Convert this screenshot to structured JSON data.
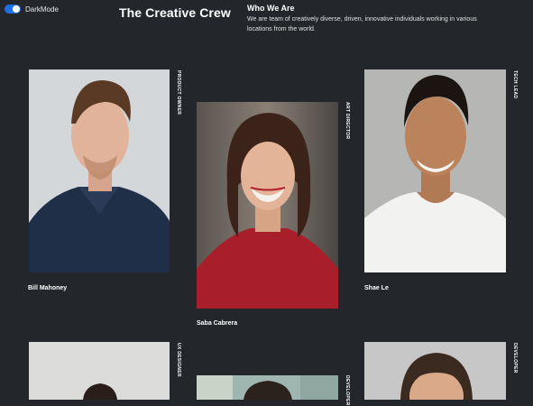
{
  "settings": {
    "dark_mode_label": "DarkMode",
    "dark_mode_on": true,
    "accent": "#1d6fe8"
  },
  "header": {
    "title": "The Creative Crew"
  },
  "about": {
    "heading": "Who We Are",
    "text": "We are team of creatively diverse, driven, innovative individuals working in various locations from the world."
  },
  "members": [
    {
      "name": "Bill Mahoney",
      "role": "PRODUCT OWNER"
    },
    {
      "name": "Saba Cabrera",
      "role": "ART DIRECTOR"
    },
    {
      "name": "Shae Le",
      "role": "TECH LEAD"
    },
    {
      "name": "",
      "role": "UX DESIGNER"
    },
    {
      "name": "",
      "role": "DEVELOPER"
    },
    {
      "name": "",
      "role": "DEVELOPER"
    }
  ],
  "colors": {
    "background": "#23262b",
    "text": "#ffffff"
  }
}
